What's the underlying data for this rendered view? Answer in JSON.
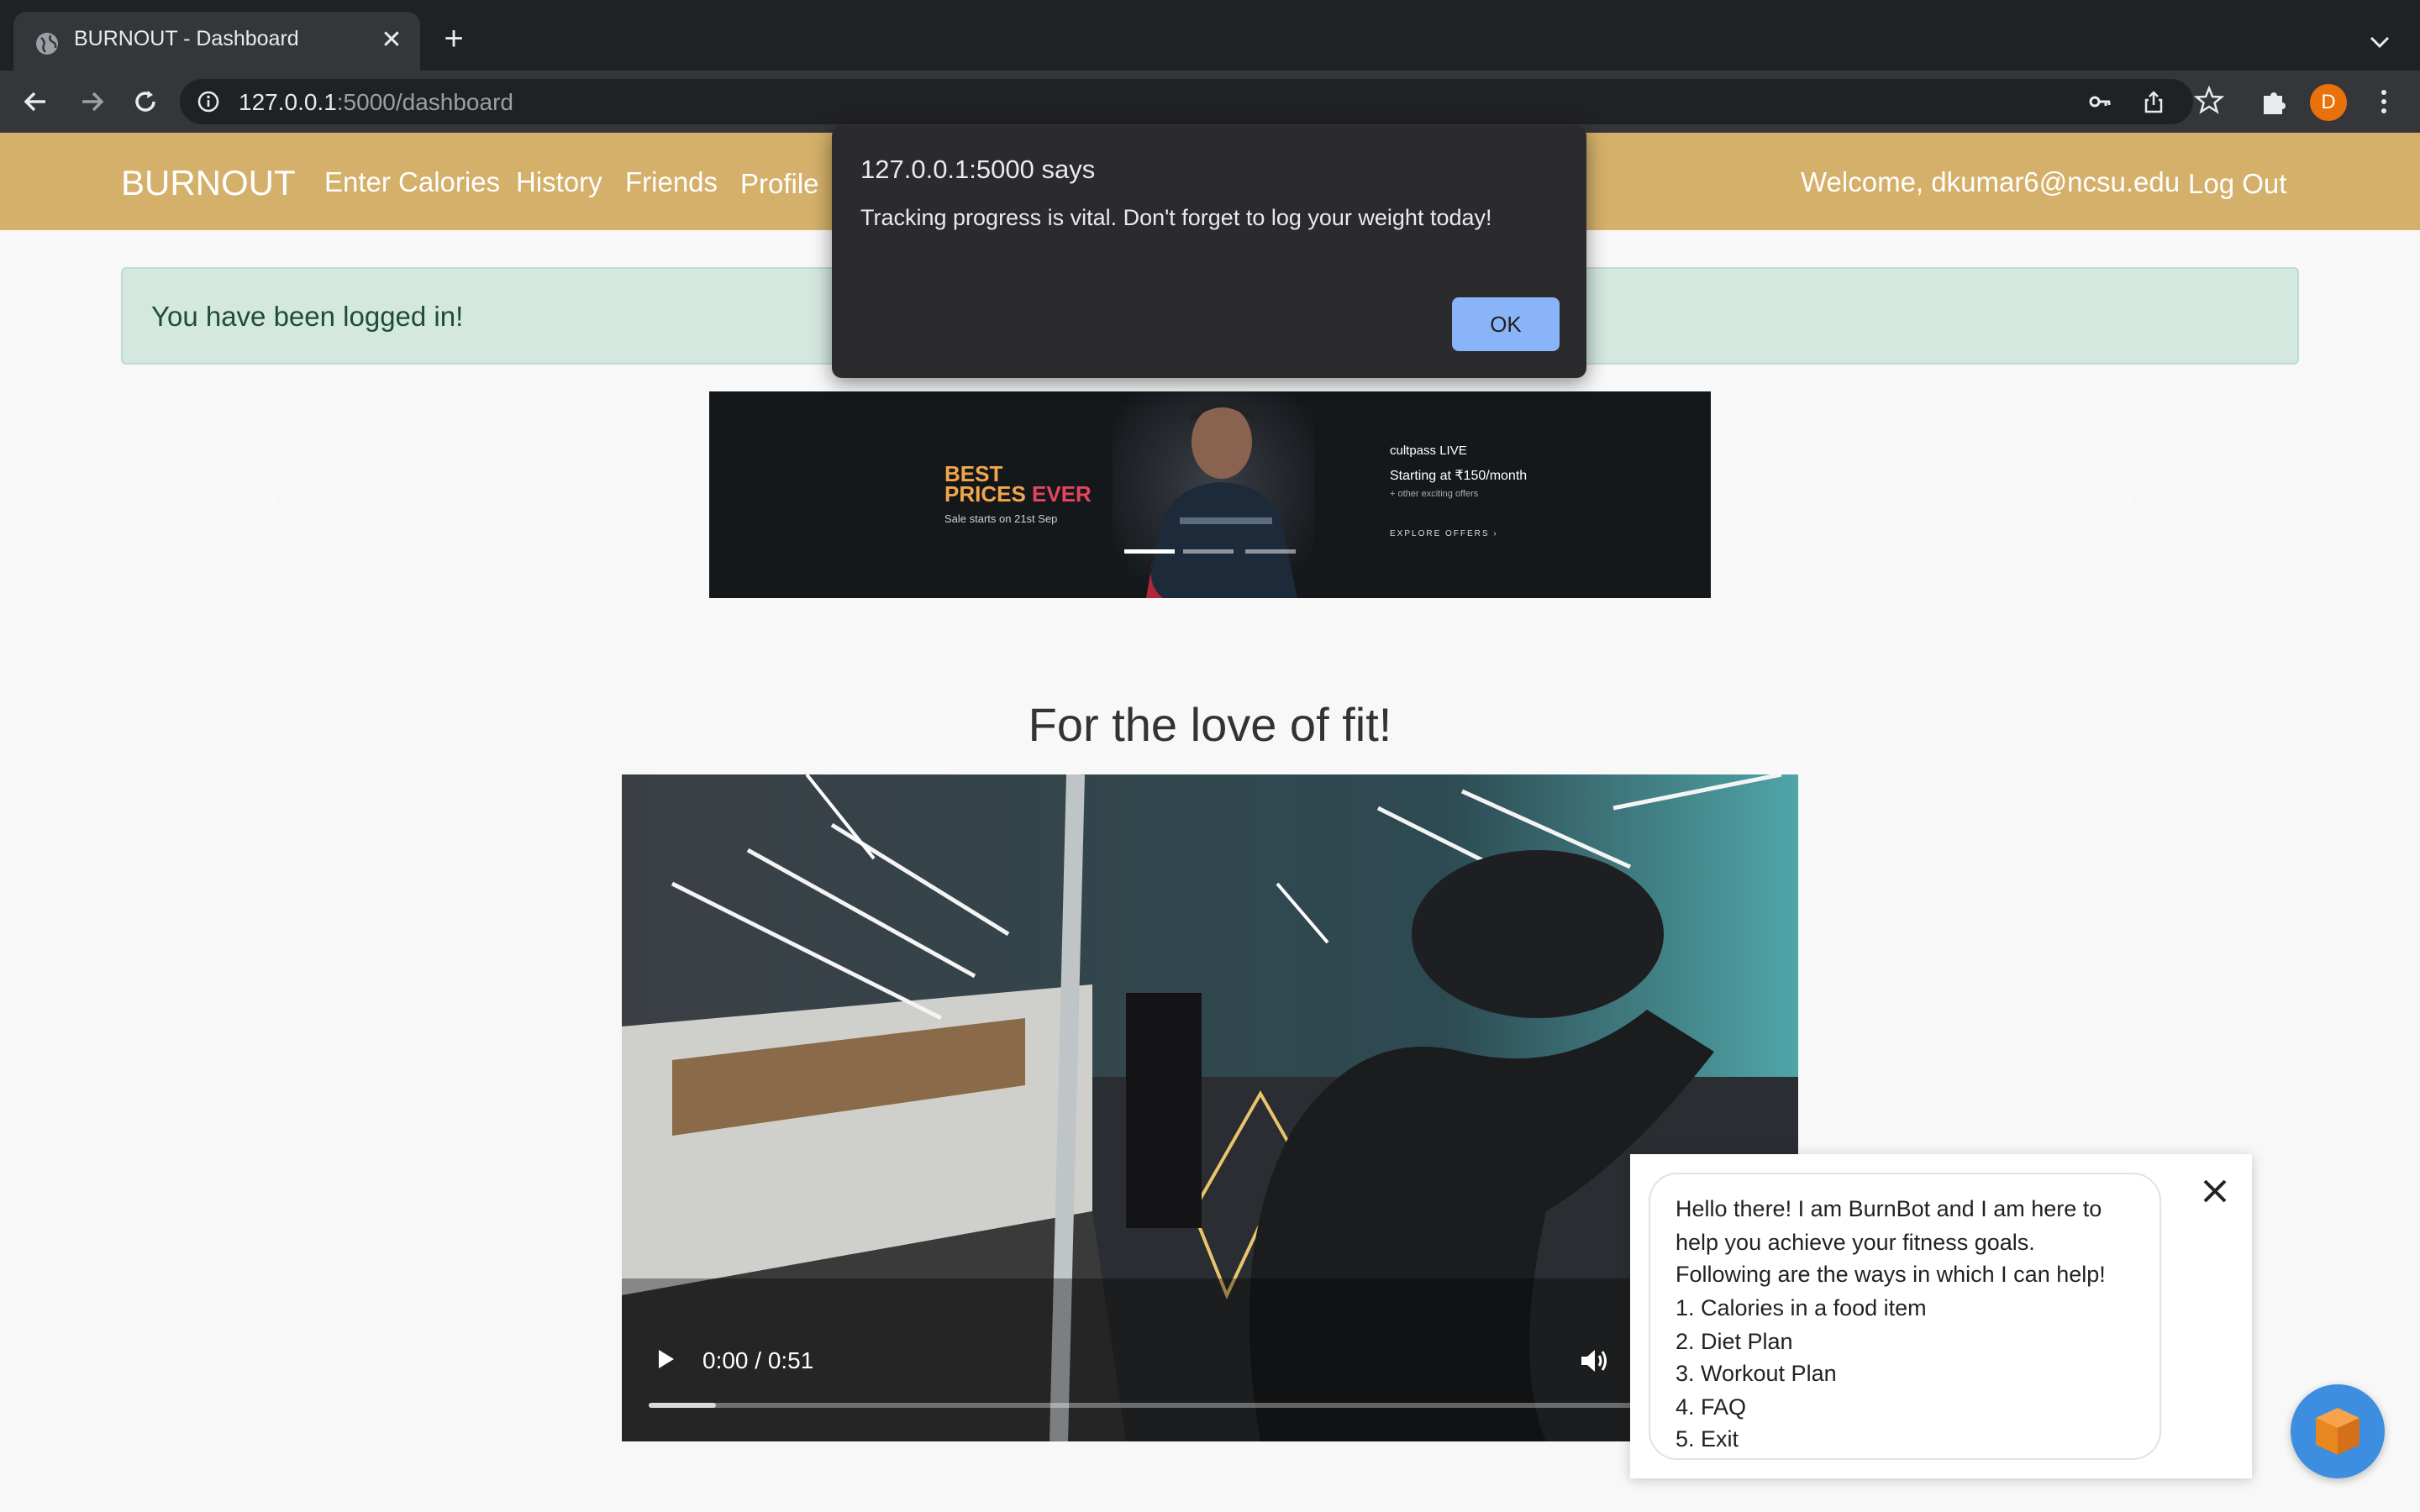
{
  "browser": {
    "tab_title": "BURNOUT - Dashboard",
    "url_host": "127.0.0.1",
    "url_rest": ":5000/dashboard",
    "avatar_letter": "D"
  },
  "navbar": {
    "brand": "BURNOUT",
    "links": [
      "Enter Calories",
      "History",
      "Friends",
      "Profile"
    ],
    "welcome": "Welcome, dkumar6@ncsu.edu",
    "logout": "Log Out"
  },
  "alert": {
    "message": "You have been logged in!"
  },
  "carousel": {
    "best": "BEST",
    "prices_a": "PRICES ",
    "prices_b": "EVER",
    "sale": "Sale starts on 21st Sep",
    "cultpass": "cultpass LIVE",
    "price_line": "Starting at ₹150/month",
    "offers_line": "+ other exciting offers",
    "explore": "EXPLORE OFFERS ›",
    "active_slide": 1,
    "slide_count": 3
  },
  "headline": "For the love of fit!",
  "video": {
    "time": "0:00 / 0:51",
    "buffered_fraction": 0.06
  },
  "dialog": {
    "title": "127.0.0.1:5000 says",
    "message": "Tracking progress is vital. Don't forget to log your weight today!",
    "ok": "OK"
  },
  "chatbot": {
    "lines": [
      "Hello there! I am BurnBot and I am here to",
      "help you achieve your fitness goals.",
      "Following are the ways in which I can help!",
      "1. Calories in a food item",
      "2. Diet Plan",
      "3. Workout Plan",
      "4. FAQ",
      "5. Exit"
    ]
  },
  "colors": {
    "navbar": "#d4b06a",
    "alert_bg": "#d4e8e0",
    "dialog_ok": "#8ab4f8",
    "chat_fab": "#3d8de0"
  }
}
